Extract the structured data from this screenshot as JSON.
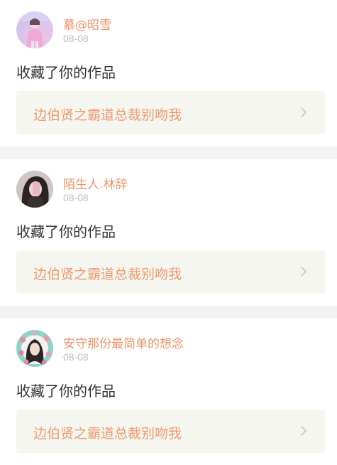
{
  "feed": {
    "items": [
      {
        "username": "慕@昭雪",
        "date": "08-08",
        "action": "收藏了你的作品",
        "work_title": "边伯贤之霸道总裁别吻我",
        "avatar_icon": "user-avatar-pink-outfit"
      },
      {
        "username": "陌生人.林辞",
        "date": "08-08",
        "action": "收藏了你的作品",
        "work_title": "边伯贤之霸道总裁别吻我",
        "avatar_icon": "user-avatar-selfie"
      },
      {
        "username": "安守那份最简单的想念",
        "date": "08-08",
        "action": "收藏了你的作品",
        "work_title": "边伯贤之霸道总裁别吻我",
        "avatar_icon": "user-avatar-flower-frame"
      }
    ]
  },
  "colors": {
    "username": "#e9956a",
    "work_title": "#ee9a6c",
    "date": "#bdbdbd",
    "action_text": "#333333",
    "work_box_bg": "#f6f6f1",
    "separator": "#f3f3f3"
  }
}
